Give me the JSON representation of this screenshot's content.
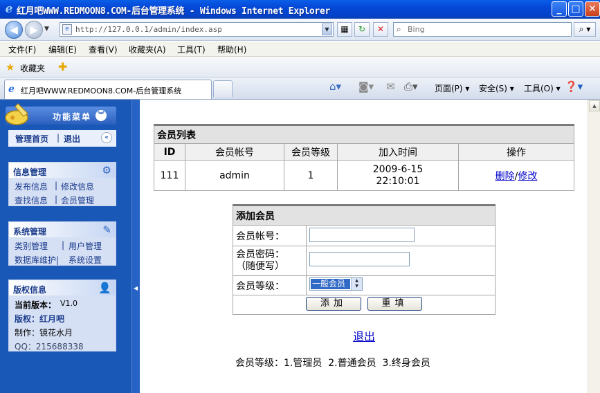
{
  "window": {
    "title": "红月吧WWW.REDMOON8.COM-后台管理系统 - Windows Internet Explorer",
    "minimize": "_",
    "maximize": "□",
    "close": "✕"
  },
  "address": {
    "url": "http://127.0.0.1/admin/index.asp",
    "search_placeholder": "Bing"
  },
  "menubar": [
    "文件(F)",
    "编辑(E)",
    "查看(V)",
    "收藏夹(A)",
    "工具(T)",
    "帮助(H)"
  ],
  "favorites": {
    "label": "收藏夹"
  },
  "tab": {
    "label": "红月吧WWW.REDMOON8.COM-后台管理系统"
  },
  "commands": {
    "page": "页面(P) ▾",
    "safety": "安全(S) ▾",
    "tools": "工具(O) ▾"
  },
  "sidebar": {
    "menu_title": "功能菜单",
    "home": "管理首页",
    "sep": "|",
    "logout": "退出",
    "info_panel": {
      "title": "信息管理",
      "items": [
        "发布信息",
        "修改信息",
        "查找信息",
        "会员管理"
      ]
    },
    "sys_panel": {
      "title": "系统管理",
      "items": [
        "类别管理",
        "用户管理",
        "数据库维护|",
        "系统设置"
      ]
    },
    "copyright_panel": {
      "title": "版权信息",
      "version_label": "当前版本：",
      "version_value": "V1.0",
      "owner": "版权：红月吧",
      "maker": "制作：镜花水月",
      "qq": "QQ：215688338"
    }
  },
  "member_list": {
    "title": "会员列表",
    "columns": [
      "ID",
      "会员帐号",
      "会员等级",
      "加入时间",
      "操作"
    ],
    "rows": [
      {
        "id": "111",
        "account": "admin",
        "level": "1",
        "date": "2009-6-15",
        "time": "22:10:01",
        "delete": "删除",
        "slash": "/",
        "edit": "修改"
      }
    ]
  },
  "add_member": {
    "title": "添加会员",
    "account_label": "会员帐号：",
    "password_label": "会员密码：",
    "password_hint": "（随便写）",
    "level_label": "会员等级：",
    "level_selected": "一般会员",
    "submit": "添加",
    "reset": "重填"
  },
  "footer": {
    "logout_link": "退出",
    "level_note": "会员等级：1.管理员  2.普通会员  3.终身会员"
  }
}
